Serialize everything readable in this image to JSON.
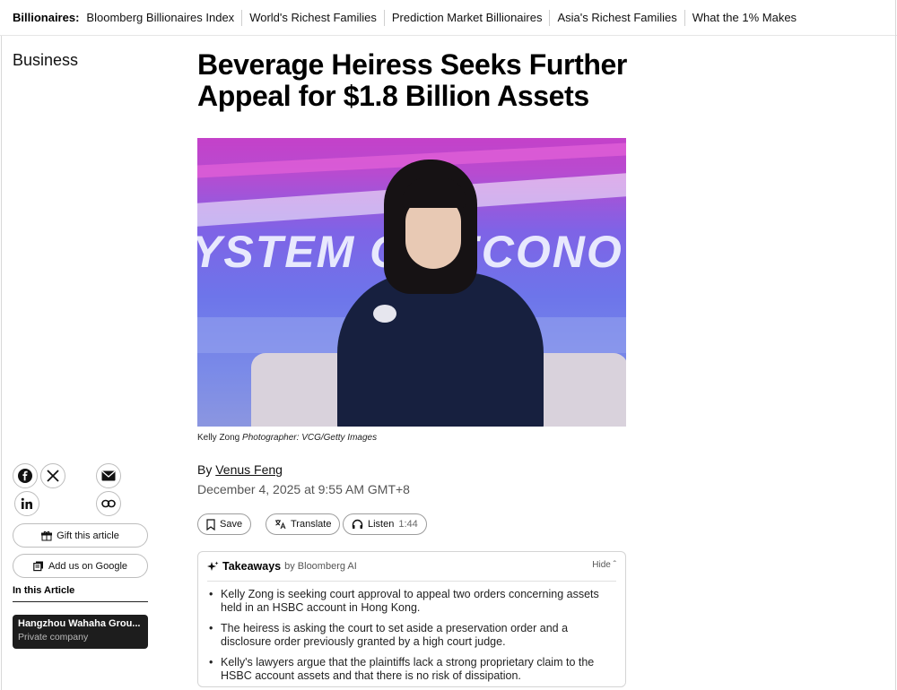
{
  "topnav": {
    "label": "Billionaires:",
    "links": [
      "Bloomberg Billionaires Index",
      "World's Richest Families",
      "Prediction Market Billionaires",
      "Asia's Richest Families",
      "What the 1% Makes"
    ]
  },
  "section": "Business",
  "headline": "Beverage Heiress Seeks Further Appeal for $1.8 Billion Assets",
  "hero": {
    "stage_text": "YSTEM OF ECONO"
  },
  "caption": {
    "subject": "Kelly Zong",
    "credit": "Photographer: VCG/Getty Images"
  },
  "share": {
    "icons": [
      "facebook-icon",
      "x-icon",
      "email-icon",
      "linkedin-icon",
      "link-icon"
    ],
    "gift_label": "Gift this article",
    "google_label": "Add us on Google"
  },
  "in_article": {
    "label": "In this Article",
    "company_name": "Hangzhou Wahaha Grou...",
    "company_type": "Private company"
  },
  "byline": {
    "prefix": "By",
    "author": "Venus Feng",
    "date": "December 4, 2025 at 9:55 AM GMT+8"
  },
  "actions": {
    "save": "Save",
    "translate": "Translate",
    "listen": "Listen",
    "listen_duration": "1:44"
  },
  "takeaways": {
    "title": "Takeaways",
    "by": "by Bloomberg AI",
    "hide": "Hide",
    "items": [
      "Kelly Zong is seeking court approval to appeal two orders concerning assets held in an HSBC account in Hong Kong.",
      "The heiress is asking the court to set aside a preservation order and a disclosure order previously granted by a high court judge.",
      "Kelly's lawyers argue that the plaintiffs lack a strong proprietary claim to the HSBC account assets and that there is no risk of dissipation."
    ]
  }
}
